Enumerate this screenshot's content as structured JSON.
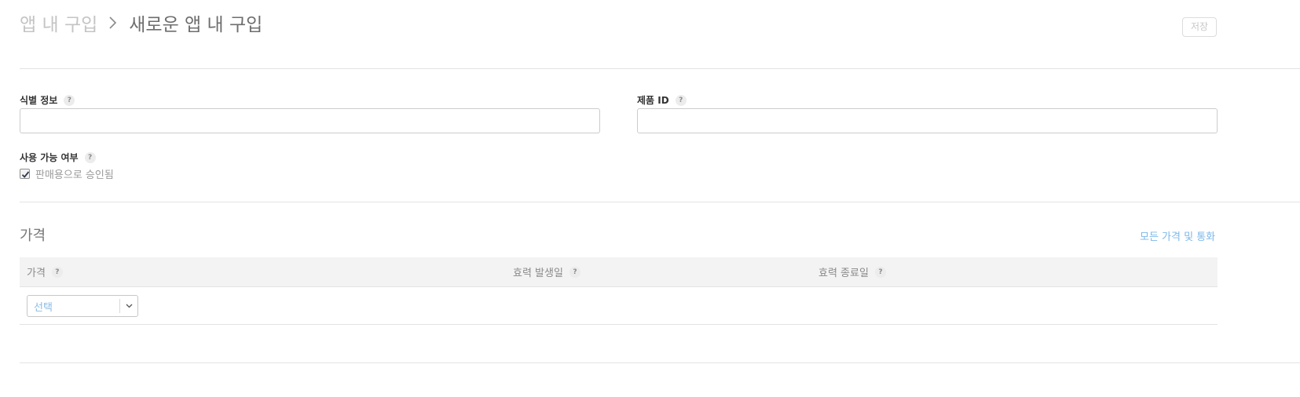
{
  "header": {
    "breadcrumb_parent": "앱 내 구입",
    "breadcrumb_current": "새로운 앱 내 구입",
    "save_label": "저장"
  },
  "form": {
    "reference_name_label": "식별 정보",
    "reference_name_value": "",
    "product_id_label": "제품 ID",
    "product_id_value": "",
    "availability_label": "사용 가능 여부",
    "cleared_for_sale_label": "판매용으로 승인됨",
    "cleared_for_sale_checked": true
  },
  "pricing": {
    "section_title": "가격",
    "all_prices_link": "모든 가격 및 통화",
    "columns": {
      "price": "가격",
      "start_date": "효력 발생일",
      "end_date": "효력 종료일"
    },
    "price_select_value": "선택"
  },
  "icons": {
    "help": "?",
    "chevron_right": "chevron-right-icon",
    "chevron_down": "chevron-down-icon",
    "checkmark": "checkmark-icon"
  },
  "colors": {
    "link": "#7cb8e8",
    "select_text": "#8bbbe6"
  }
}
